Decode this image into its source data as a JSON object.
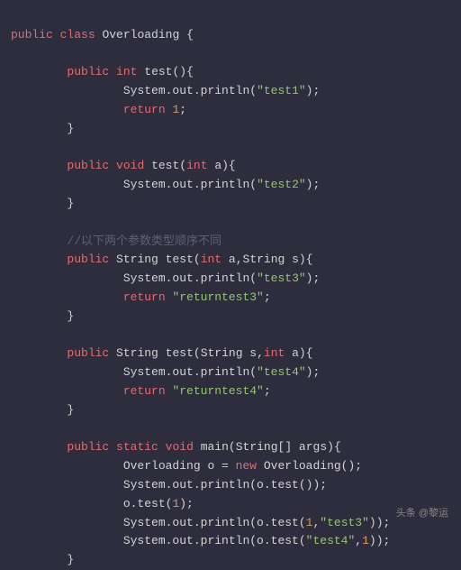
{
  "code": {
    "line1_kw1": "public",
    "line1_kw2": "class",
    "line1_name": "Overloading",
    "line1_brace": " {",
    "blank": "",
    "indent1": "        ",
    "indent2": "                ",
    "m1_kw1": "public",
    "m1_kw2": "int",
    "m1_name": "test",
    "m1_sig": "(){",
    "m1_body1a": "System.out.println(",
    "m1_str1": "\"test1\"",
    "m1_body1b": ");",
    "m1_ret_kw": "return",
    "m1_ret_val": " 1",
    "m1_ret_end": ";",
    "brace_close": "}",
    "m2_kw1": "public",
    "m2_kw2": "void",
    "m2_name": "test",
    "m2_sig_a": "(",
    "m2_kw3": "int",
    "m2_sig_b": " a){",
    "m2_body1a": "System.out.println(",
    "m2_str1": "\"test2\"",
    "m2_body1b": ");",
    "comment1": "//以下两个参数类型顺序不同",
    "m3_kw1": "public",
    "m3_type": "String",
    "m3_name": "test",
    "m3_sig_a": "(",
    "m3_kw2": "int",
    "m3_sig_b": " a,String s){",
    "m3_body1a": "System.out.println(",
    "m3_str1": "\"test3\"",
    "m3_body1b": ");",
    "m3_ret_kw": "return",
    "m3_ret_str": " \"returntest3\"",
    "m3_ret_end": ";",
    "m4_kw1": "public",
    "m4_type": "String",
    "m4_name": "test",
    "m4_sig_a": "(String s,",
    "m4_kw2": "int",
    "m4_sig_b": " a){",
    "m4_body1a": "System.out.println(",
    "m4_str1": "\"test4\"",
    "m4_body1b": ");",
    "m4_ret_kw": "return",
    "m4_ret_str": " \"returntest4\"",
    "m4_ret_end": ";",
    "main_kw1": "public",
    "main_kw2": "static",
    "main_kw3": "void",
    "main_name": "main",
    "main_sig": "(String[] args){",
    "main_l1a": "Overloading o = ",
    "main_l1_kw": "new",
    "main_l1b": " Overloading();",
    "main_l2": "System.out.println(o.test());",
    "main_l3a": "o.test(",
    "main_l3_num": "1",
    "main_l3b": ");",
    "main_l4a": "System.out.println(o.test(",
    "main_l4_num": "1",
    "main_l4b": ",",
    "main_l4_str": "\"test3\"",
    "main_l4c": "));",
    "main_l5a": "System.out.println(o.test(",
    "main_l5_str": "\"test4\"",
    "main_l5b": ",",
    "main_l5_num": "1",
    "main_l5c": "));"
  },
  "watermark": "头条 @黎运"
}
